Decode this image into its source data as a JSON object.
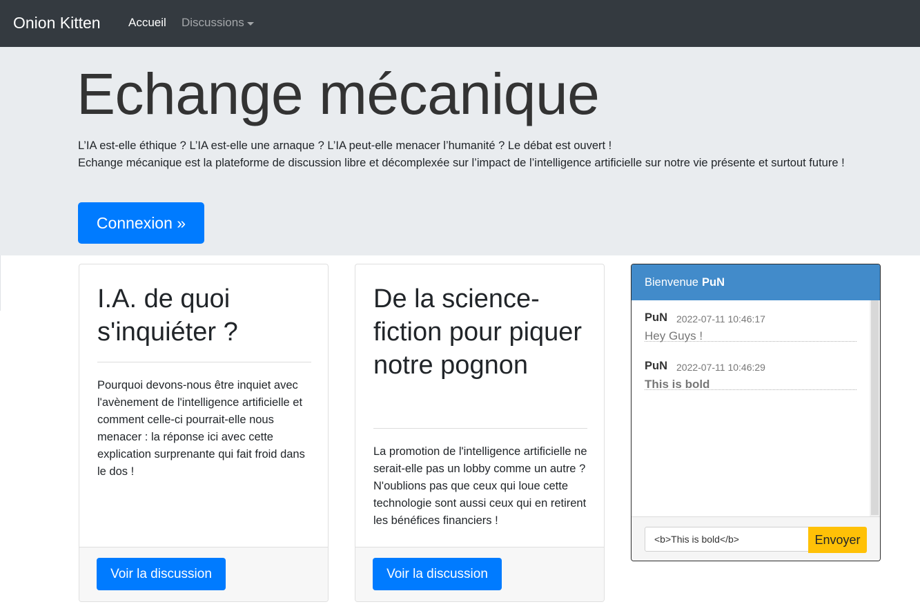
{
  "navbar": {
    "brand": "Onion Kitten",
    "links": [
      {
        "label": "Accueil"
      },
      {
        "label": "Discussions"
      }
    ]
  },
  "jumbotron": {
    "title": "Echange mécanique",
    "line1": "L’IA est-elle éthique ? L’IA est-elle une arnaque ? L’IA peut-elle menacer l’humanité ? Le débat est ouvert !",
    "line2": "Echange mécanique est la plateforme de discussion libre et décomplexée sur l’impact de l’intelligence artificielle sur notre vie présente et surtout future !",
    "button": "Connexion »"
  },
  "cards": [
    {
      "title": "I.A. de quoi s'inquiéter ?",
      "text": "Pourquoi devons-nous être inquiet avec l'avènement de l'intelligence artificielle et comment celle-ci pourrait-elle nous menacer : la réponse ici avec cette explication surprenante qui fait froid dans le dos !",
      "button": "Voir la discussion"
    },
    {
      "title": "De la science-fiction pour piquer notre pognon",
      "text": "La promotion de l'intelligence artificielle ne serait-elle pas un lobby comme un autre ? N'oublions pas que ceux qui loue cette technologie sont aussi ceux qui en retirent les bénéfices financiers !",
      "button": "Voir la discussion"
    }
  ],
  "chat": {
    "welcome": "Bienvenue",
    "user": "PuN",
    "messages": [
      {
        "author": "PuN",
        "time": "2022-07-11 10:46:17",
        "text": "Hey Guys !",
        "bold": false
      },
      {
        "author": "PuN",
        "time": "2022-07-11 10:46:29",
        "text": "This is bold",
        "bold": true
      }
    ],
    "input_value": "<b>This is bold</b>",
    "send_label": "Envoyer"
  },
  "colors": {
    "navbar": "#343a40",
    "jumbotron": "#e9ecef",
    "primary": "#007bff",
    "chat_header": "#428bca",
    "send_button": "#ffc107"
  }
}
